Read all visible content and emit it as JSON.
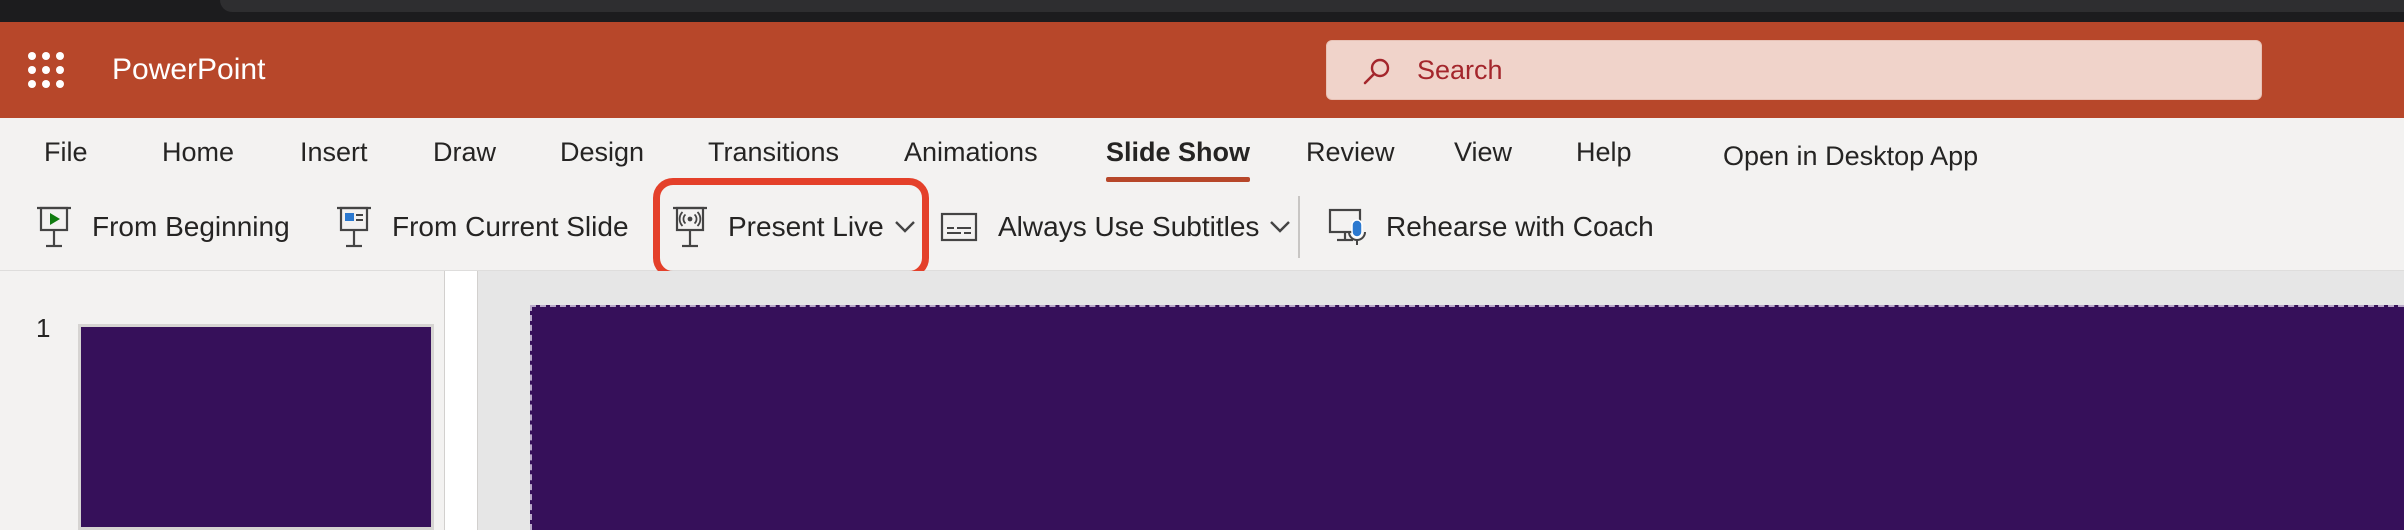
{
  "app": {
    "name": "PowerPoint"
  },
  "search": {
    "placeholder": "Search"
  },
  "menu": {
    "items": [
      {
        "label": "File"
      },
      {
        "label": "Home"
      },
      {
        "label": "Insert"
      },
      {
        "label": "Draw"
      },
      {
        "label": "Design"
      },
      {
        "label": "Transitions"
      },
      {
        "label": "Animations"
      },
      {
        "label": "Slide Show",
        "active": true
      },
      {
        "label": "Review"
      },
      {
        "label": "View"
      },
      {
        "label": "Help"
      },
      {
        "label": "Open in Desktop App"
      }
    ]
  },
  "ribbon": {
    "from_beginning": "From Beginning",
    "from_current_slide": "From Current Slide",
    "present_live": "Present Live",
    "always_use_subtitles": "Always Use Subtitles",
    "rehearse_with_coach": "Rehearse with Coach"
  },
  "thumbnails": [
    {
      "number": "1"
    }
  ],
  "colors": {
    "brand": "#b7472a",
    "slide_background": "#36105a",
    "highlight": "#e4402a"
  }
}
